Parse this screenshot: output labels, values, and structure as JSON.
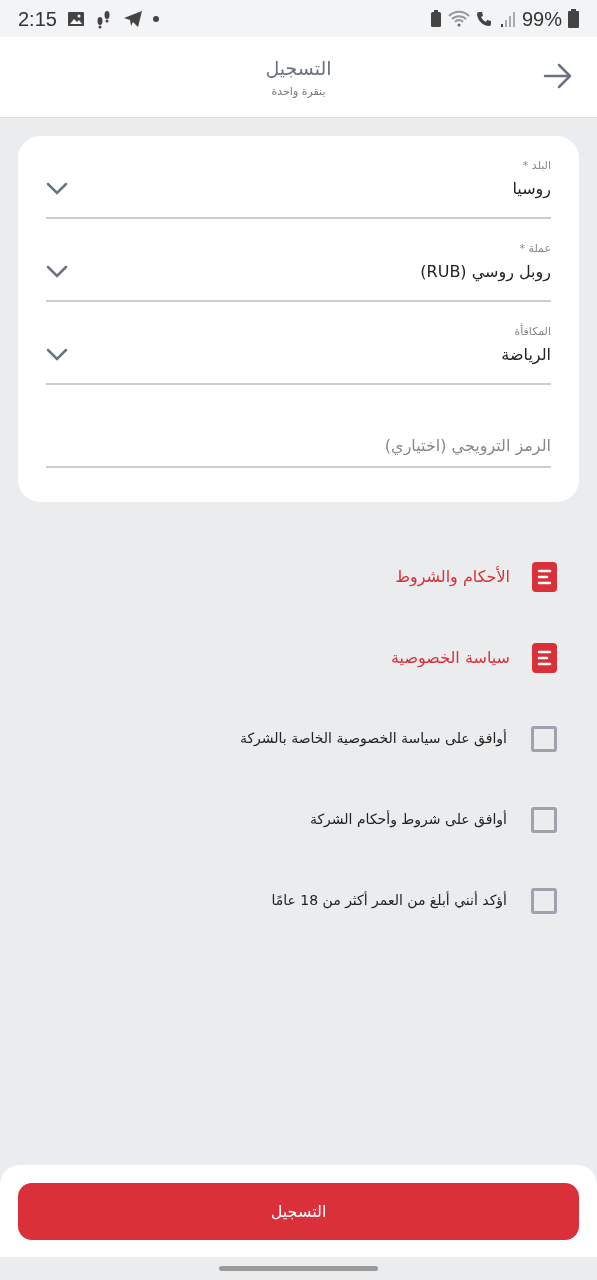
{
  "status_bar": {
    "time": "2:15",
    "battery": "99%"
  },
  "header": {
    "title": "التسجيل",
    "subtitle": "بنقرة واحدة"
  },
  "fields": [
    {
      "kind": "select",
      "label": "البلد *",
      "value": "روسيا"
    },
    {
      "kind": "select",
      "label": "عملة *",
      "value": "روبل روسي (RUB)"
    },
    {
      "kind": "select",
      "label": "المكافأة",
      "value": "الرياضة"
    },
    {
      "kind": "text",
      "placeholder": "الرمز الترويجي (اختياري)"
    }
  ],
  "links": [
    {
      "label": "الأحكام والشروط"
    },
    {
      "label": "سياسة الخصوصية"
    }
  ],
  "agreements": [
    {
      "label": "أوافق على سياسة الخصوصية الخاصة بالشركة",
      "checked": false
    },
    {
      "label": "أوافق على شروط وأحكام الشركة",
      "checked": false
    },
    {
      "label": "أؤكد أنني أبلغ من العمر أكثر من 18 عامًا",
      "checked": false
    }
  ],
  "submit": {
    "label": "التسجيل"
  }
}
